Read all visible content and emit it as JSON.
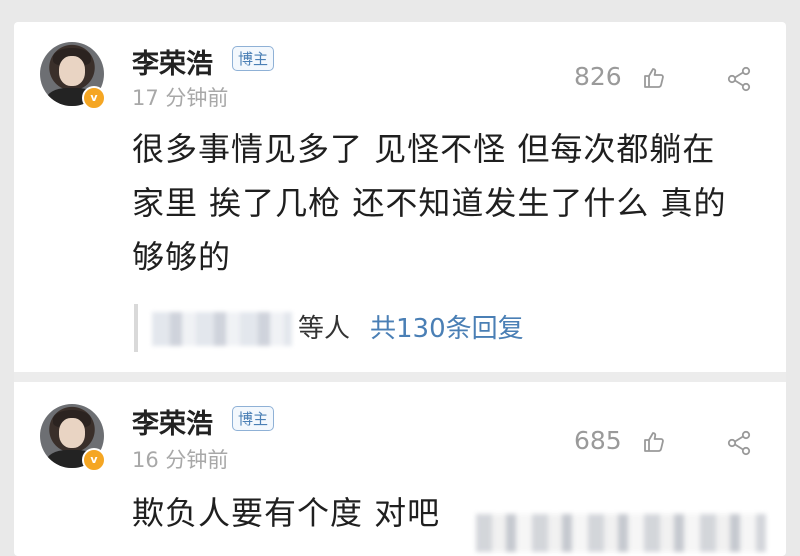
{
  "comments": [
    {
      "username": "李荣浩",
      "tag": "博主",
      "verified_mark": "v",
      "time": "17 分钟前",
      "likes": "826",
      "text_line1": "很多事情见多了 见怪不怪 但每次都躺在",
      "text_line2": "家里 挨了几枪 还不知道发生了什么 真的",
      "text_line3": "够够的",
      "replies_suffix": "等人",
      "replies_count": "共130条回复"
    },
    {
      "username": "李荣浩",
      "tag": "博主",
      "verified_mark": "v",
      "time": "16 分钟前",
      "likes": "685",
      "text_line1": "欺负人要有个度 对吧"
    }
  ],
  "icons": {
    "like": "thumbs-up-icon",
    "share": "share-icon",
    "verified": "verified-badge-icon"
  },
  "colors": {
    "link": "#4a7fb5",
    "badge": "#f5a623",
    "muted": "#a8a8a8"
  }
}
